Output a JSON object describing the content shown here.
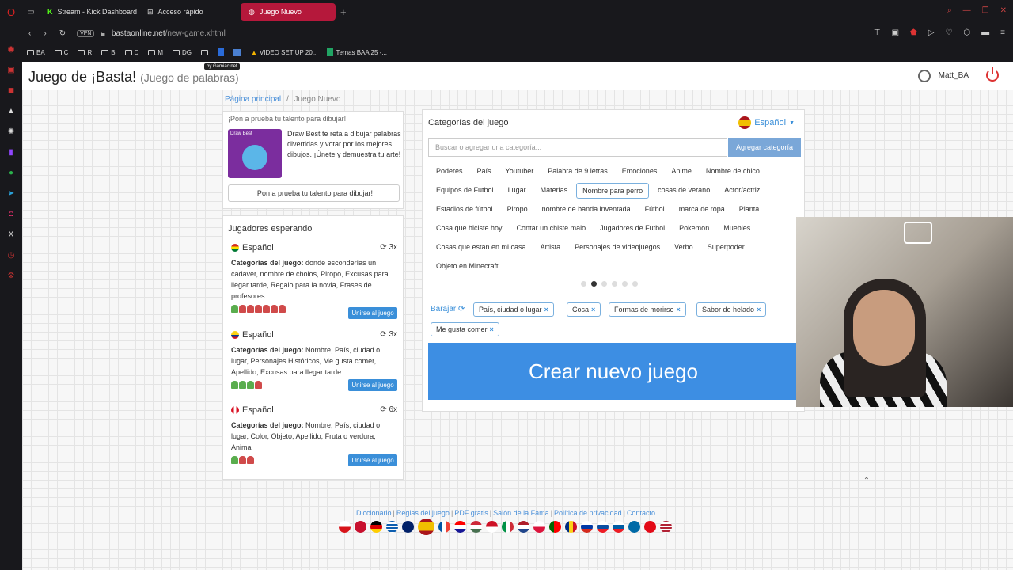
{
  "browser": {
    "tabs": [
      {
        "label": "Stream - Kick Dashboard",
        "icon": "kick-icon"
      },
      {
        "label": "Acceso rápido",
        "icon": "grid-icon"
      },
      {
        "label": "Juego Nuevo",
        "icon": "globe-icon",
        "active": true
      }
    ],
    "url_host": "bastaonline.net",
    "url_path": "/new-game.xhtml",
    "vpn_label": "VPN",
    "bookmarks": [
      "BA",
      "C",
      "R",
      "B",
      "D",
      "M",
      "DG",
      "",
      "",
      "",
      "VIDEO SET UP 20...",
      "Ternas BAA 25 -..."
    ]
  },
  "header": {
    "title": "Juego de ¡Basta!",
    "subtitle": "(Juego de palabras)",
    "gamiac": "by Gamiac.net",
    "username": "Matt_BA"
  },
  "breadcrumb": {
    "home": "Página principal",
    "sep": "/",
    "current": "Juego Nuevo"
  },
  "promo": {
    "heading": "¡Pon a prueba tu talento para dibujar!",
    "img_text": "Draw Best",
    "text": "Draw Best te reta a dibujar palabras divertidas y votar por los mejores dibujos. ¡Únete y demuestra tu arte!",
    "button": "¡Pon a prueba tu talento para dibujar!"
  },
  "players": {
    "heading": "Jugadores esperando",
    "cats_label": "Categorías del juego:",
    "join_label": "Unirse al juego",
    "games": [
      {
        "lang": "Español",
        "count": "3x",
        "cats": "donde esconderías un cadaver, nombre de cholos, Piropo, Excusas para llegar tarde, Regalo para la novia, Frases de profesores",
        "green": 1,
        "red": 6,
        "flag": "bolivia"
      },
      {
        "lang": "Español",
        "count": "3x",
        "cats": "Nombre, País, ciudad o lugar, Personajes Históricos, Me gusta comer, Apellido, Excusas para llegar tarde",
        "green": 3,
        "red": 1,
        "flag": "colombia"
      },
      {
        "lang": "Español",
        "count": "6x",
        "cats": "Nombre, País, ciudad o lugar, Color, Objeto, Apellido, Fruta o verdura, Animal",
        "green": 1,
        "red": 2,
        "flag": "peru"
      }
    ]
  },
  "categories": {
    "heading": "Categorías del juego",
    "language": "Español",
    "search_placeholder": "Buscar o agregar una categoría...",
    "add_button": "Agregar categoría",
    "rows": [
      [
        "Poderes",
        "País",
        "Youtuber",
        "Palabra de 9 letras",
        "Emociones",
        "Anime",
        "Nombre de chico"
      ],
      [
        "Equipos de Futbol",
        "Lugar",
        "Materias",
        "Nombre para perro",
        "cosas de verano",
        "Actor/actriz"
      ],
      [
        "Estadios de fútbol",
        "Piropo",
        "nombre de banda inventada",
        "Fútbol",
        "marca de ropa",
        "Planta"
      ],
      [
        "Cosa que hiciste hoy",
        "Contar un chiste malo",
        "Jugadores de Futbol",
        "Pokemon",
        "Muebles"
      ],
      [
        "Cosas que estan en mi casa",
        "Artista",
        "Personajes de videojuegos",
        "Verbo",
        "Superpoder"
      ],
      [
        "Objeto en Minecraft"
      ]
    ],
    "highlighted": "Nombre para perro",
    "shuffle_label": "Barajar",
    "selected": [
      "País, ciudad o lugar",
      "Cosa",
      "Formas de morirse",
      "Sabor de helado",
      "Me gusta comer"
    ],
    "create_button": "Crear nuevo juego",
    "page_dots": 6,
    "active_dot": 2
  },
  "footer": {
    "links": [
      "Diccionario",
      "Reglas del juego",
      "PDF gratis",
      "Salón de la Fama",
      "Política de privacidad",
      "Contacto"
    ]
  },
  "colors": {
    "accent": "#3d8ee3",
    "tab_active": "#b5183b",
    "power": "#dd3333"
  }
}
